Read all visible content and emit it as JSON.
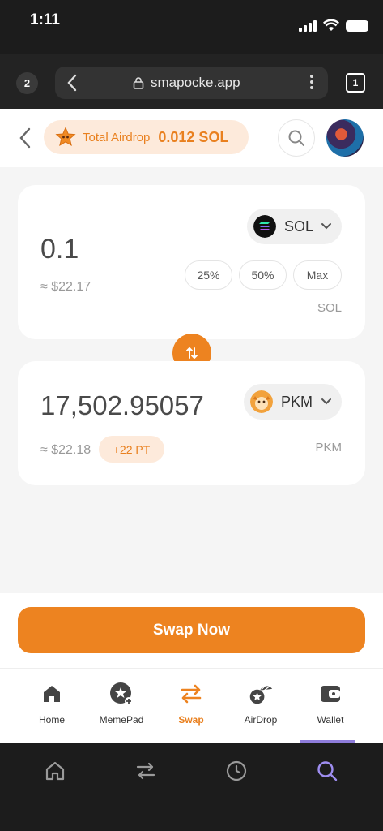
{
  "status_bar": {
    "time": "1:11"
  },
  "browser": {
    "tab_count_left": "2",
    "url": "smapocke.app",
    "tabs_count": "1"
  },
  "header": {
    "airdrop_label": "Total Airdrop",
    "airdrop_value": "0.012 SOL"
  },
  "swap": {
    "from": {
      "amount": "0.1",
      "usd": "≈ $22.17",
      "token": "SOL",
      "unit": "SOL",
      "quick_amounts": [
        "25%",
        "50%",
        "Max"
      ]
    },
    "to": {
      "amount": "17,502.95057",
      "usd": "≈ $22.18",
      "points_badge": "+22 PT",
      "token": "PKM",
      "unit": "PKM"
    },
    "submit_label": "Swap Now"
  },
  "nav": {
    "items": [
      {
        "label": "Home",
        "icon": "home-icon"
      },
      {
        "label": "MemePad",
        "icon": "memepad-icon"
      },
      {
        "label": "Swap",
        "icon": "swap-icon",
        "active": true
      },
      {
        "label": "AirDrop",
        "icon": "airdrop-icon"
      },
      {
        "label": "Wallet",
        "icon": "wallet-icon"
      }
    ]
  },
  "colors": {
    "accent": "#ED8320",
    "accent_light": "#FDEADB",
    "active_indicator": "#8E7CDB"
  }
}
